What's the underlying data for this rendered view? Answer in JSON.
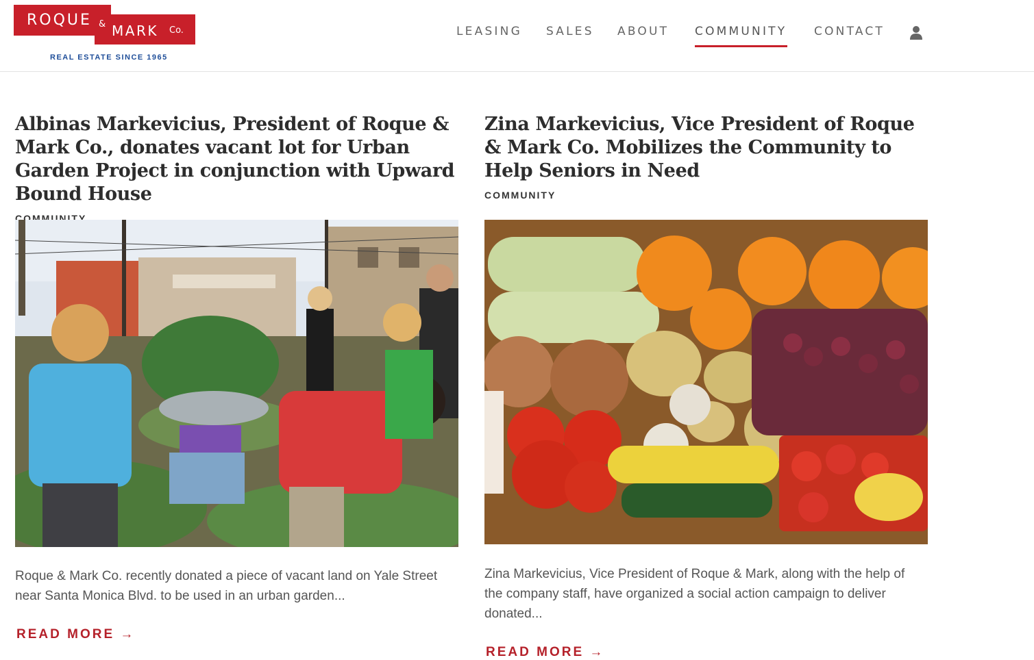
{
  "logo": {
    "line1": "ROQUE",
    "amp": "&",
    "line2": "MARK",
    "co": "Co.",
    "tagline": "REAL ESTATE SINCE 1965"
  },
  "nav": {
    "items": [
      "LEASING",
      "SALES",
      "ABOUT",
      "COMMUNITY",
      "CONTACT"
    ],
    "active": "COMMUNITY"
  },
  "articles": [
    {
      "title": "Albinas Markevicius, President of Roque & Mark Co., donates vacant lot for Urban Garden Project in conjunction with Upward Bound House",
      "category": "COMMUNITY",
      "excerpt": "Roque & Mark Co. recently donated a piece of vacant land on Yale Street near Santa Monica Blvd. to be used in an urban garden...",
      "read_more": "READ MORE →"
    },
    {
      "title": "Zina Markevicius, Vice President of Roque & Mark Co. Mobilizes the Community to Help Seniors in Need",
      "category": "COMMUNITY",
      "excerpt": "Zina Markevicius, Vice President of Roque & Mark, along with the help of the company staff, have organized a social action campaign to deliver donated...",
      "read_more": "READ MORE →"
    }
  ],
  "colors": {
    "brand_red": "#c8202a",
    "tagline_blue": "#1f4e99"
  }
}
